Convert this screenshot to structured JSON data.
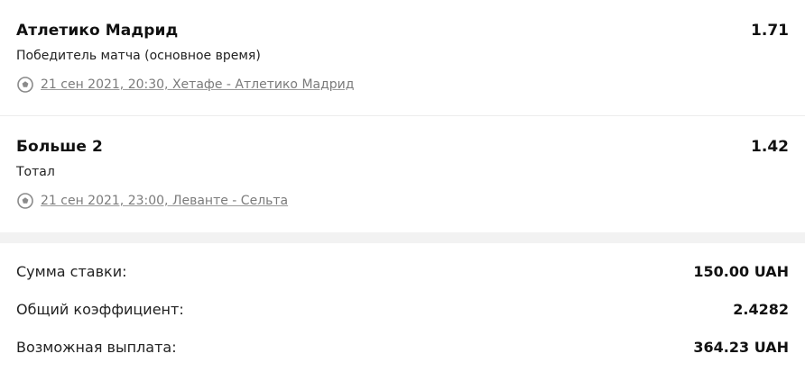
{
  "bets": [
    {
      "selection": "Атлетико Мадрид",
      "odds": "1.71",
      "market": "Победитель матча (основное время)",
      "event": "21 сен 2021, 20:30, Хетафе - Атлетико Мадрид",
      "icon": "soccer-ball-icon"
    },
    {
      "selection": "Больше 2",
      "odds": "1.42",
      "market": "Тотал",
      "event": "21 сен 2021, 23:00, Леванте - Сельта",
      "icon": "soccer-ball-icon"
    }
  ],
  "summary": {
    "stake_label": "Сумма ставки:",
    "stake_value": "150.00 UAH",
    "total_odds_label": "Общий коэффициент:",
    "total_odds_value": "2.4282",
    "payout_label": "Возможная выплата:",
    "payout_value": "364.23 UAH"
  }
}
